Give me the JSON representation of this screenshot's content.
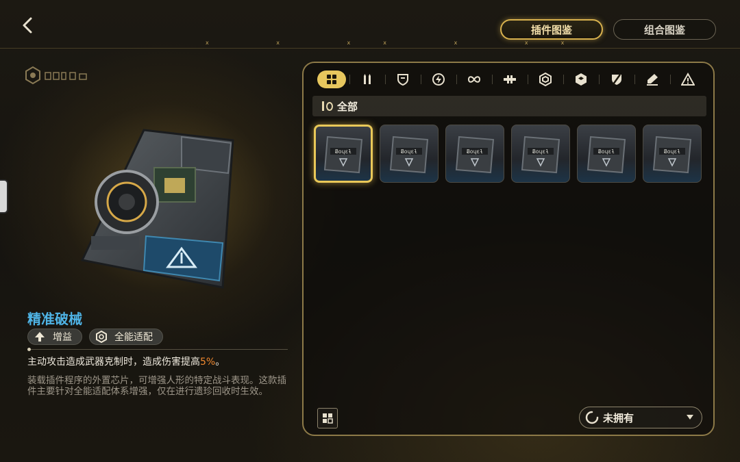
{
  "header": {
    "tabs": [
      {
        "label": "插件图鉴",
        "active": true
      },
      {
        "label": "组合图鉴",
        "active": false
      }
    ],
    "marks": "x x xx x xx"
  },
  "categories": [
    {
      "icon": "grid-icon",
      "active": true
    },
    {
      "icon": "ammo-icon",
      "active": false
    },
    {
      "icon": "shield-emblem-icon",
      "active": false
    },
    {
      "icon": "lightning-icon",
      "active": false
    },
    {
      "icon": "infinity-icon",
      "active": false
    },
    {
      "icon": "wide-symbol-icon",
      "active": false
    },
    {
      "icon": "hexagon-ring-icon",
      "active": false
    },
    {
      "icon": "hexagon-solid-icon",
      "active": false
    },
    {
      "icon": "slash-shield-icon",
      "active": false
    },
    {
      "icon": "pen-icon",
      "active": false
    },
    {
      "icon": "warning-icon",
      "active": false
    }
  ],
  "filter": {
    "label": "全部"
  },
  "plugin": {
    "name": "精准破械",
    "tags": [
      {
        "icon": "arrow-up-icon",
        "label": "增益"
      },
      {
        "icon": "hexagon-ring-icon",
        "label": "全能适配"
      }
    ],
    "effect_prefix": "主动攻击造成武器克制时，造成伤害提高",
    "effect_value": "5%",
    "effect_suffix": "。",
    "description": "装载插件程序的外置芯片，可增强人形的特定战斗表现。这款插件主要针对全能适配体系增强，仅在进行遗珍回收时生效。"
  },
  "items": [
    {
      "selected": true
    },
    {
      "selected": false
    },
    {
      "selected": false
    },
    {
      "selected": false
    },
    {
      "selected": false
    },
    {
      "selected": false
    }
  ],
  "ownership_filter": {
    "label": "未拥有"
  },
  "colors": {
    "accent": "#e7c75e",
    "name": "#4fb4e6",
    "highlight": "#f0892f"
  }
}
